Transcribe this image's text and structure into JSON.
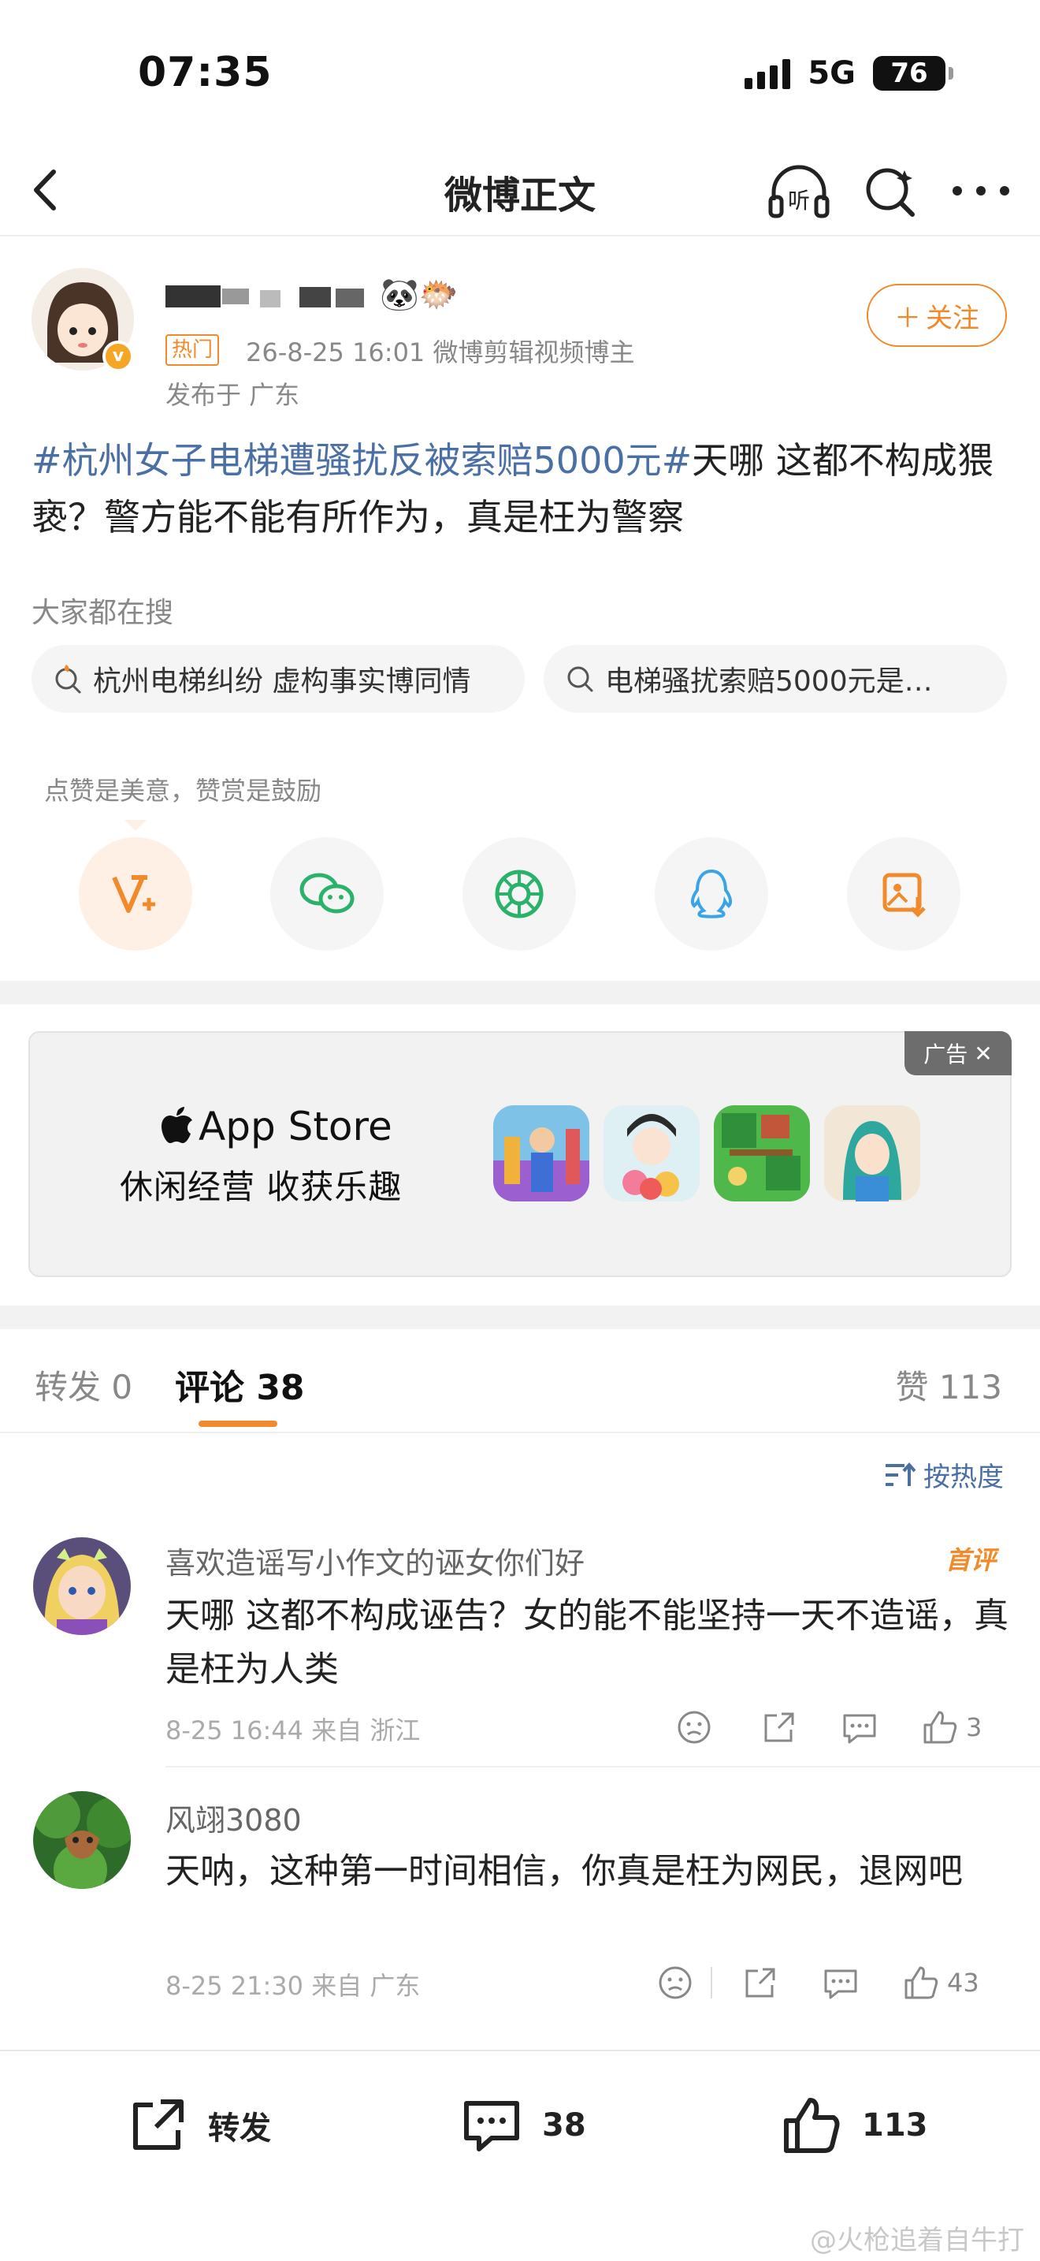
{
  "status_bar": {
    "time": "07:35",
    "network": "5G",
    "battery": "76"
  },
  "nav": {
    "title": "微博正文"
  },
  "author": {
    "emoji": "🐼🐡",
    "hot_badge": "热门",
    "meta": "26-8-25 16:01  微博剪辑视频博主",
    "location": "发布于 广东",
    "follow_label": "关注"
  },
  "post": {
    "topic": "#杭州女子电梯遭骚扰反被索赔5000元#",
    "text": "天哪 这都不构成猥亵？警方能不能有所作为，真是枉为警察"
  },
  "search": {
    "title": "大家都在搜",
    "chips": [
      "杭州电梯纠纷 虚构事实博同情",
      "电梯骚扰索赔5000元是…"
    ]
  },
  "reward_tip": "点赞是美意，赞赏是鼓励",
  "ad": {
    "label": "广告",
    "store": "App Store",
    "slogan": "休闲经营 收获乐趣"
  },
  "tabs": {
    "repost": "转发 0",
    "comment": "评论 38",
    "like": "赞 113"
  },
  "sort_label": "按热度",
  "comments": [
    {
      "name": "喜欢造谣写小作文的诬女你们好",
      "badge": "首评",
      "text": "天哪 这都不构成诬告？女的能不能坚持一天不造谣，真是枉为人类",
      "meta": "8-25 16:44 来自 浙江",
      "likes": "3"
    },
    {
      "name": "风翊3080",
      "text": "天呐，这种第一时间相信，你真是枉为网民，退网吧",
      "meta": "8-25 21:30 来自 广东",
      "likes": "43"
    }
  ],
  "bottom_bar": {
    "repost": "转发",
    "comment": "38",
    "like": "113"
  },
  "watermark": "@火枪追着自牛打",
  "colors": {
    "accent": "#f08a2a",
    "topic": "#4a6fa5"
  }
}
